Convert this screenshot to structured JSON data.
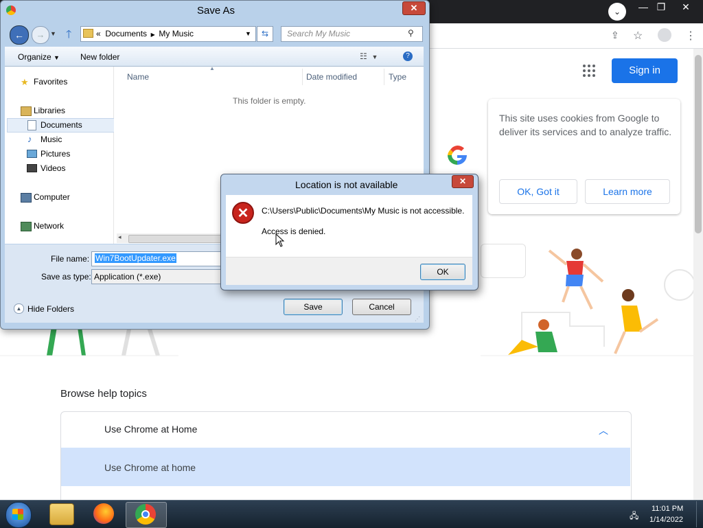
{
  "chrome": {
    "sign_in": "Sign in",
    "cookie_text": "This site uses cookies from Google to deliver its services and to analyze traffic.",
    "ok_got_it": "OK, Got it",
    "learn_more": "Learn more",
    "browse_title": "Browse help topics",
    "accordion_header": "Use Chrome at Home",
    "accordion_item": "Use Chrome at home",
    "colors": {
      "accent": "#1a73e8",
      "selected_row": "#d2e3fc"
    }
  },
  "save_as": {
    "title": "Save As",
    "breadcrumb": {
      "prefix": "«",
      "items": [
        "Documents",
        "My Music"
      ]
    },
    "search_placeholder": "Search My Music",
    "toolbar": {
      "organize": "Organize",
      "new_folder": "New folder"
    },
    "nav": {
      "favorites": "Favorites",
      "libraries": "Libraries",
      "documents": "Documents",
      "music": "Music",
      "pictures": "Pictures",
      "videos": "Videos",
      "computer": "Computer",
      "network": "Network"
    },
    "columns": [
      "Name",
      "Date modified",
      "Type"
    ],
    "empty_message": "This folder is empty.",
    "file_name_label": "File name:",
    "file_name_value": "Win7BootUpdater.exe",
    "save_as_type_label": "Save as type:",
    "save_as_type_value": "Application (*.exe)",
    "hide_folders": "Hide Folders",
    "save": "Save",
    "cancel": "Cancel"
  },
  "error_dialog": {
    "title": "Location is not available",
    "message1": "C:\\Users\\Public\\Documents\\My Music is not accessible.",
    "message2": "Access is denied.",
    "ok": "OK"
  },
  "taskbar": {
    "time": "11:01 PM",
    "date": "1/14/2022"
  }
}
